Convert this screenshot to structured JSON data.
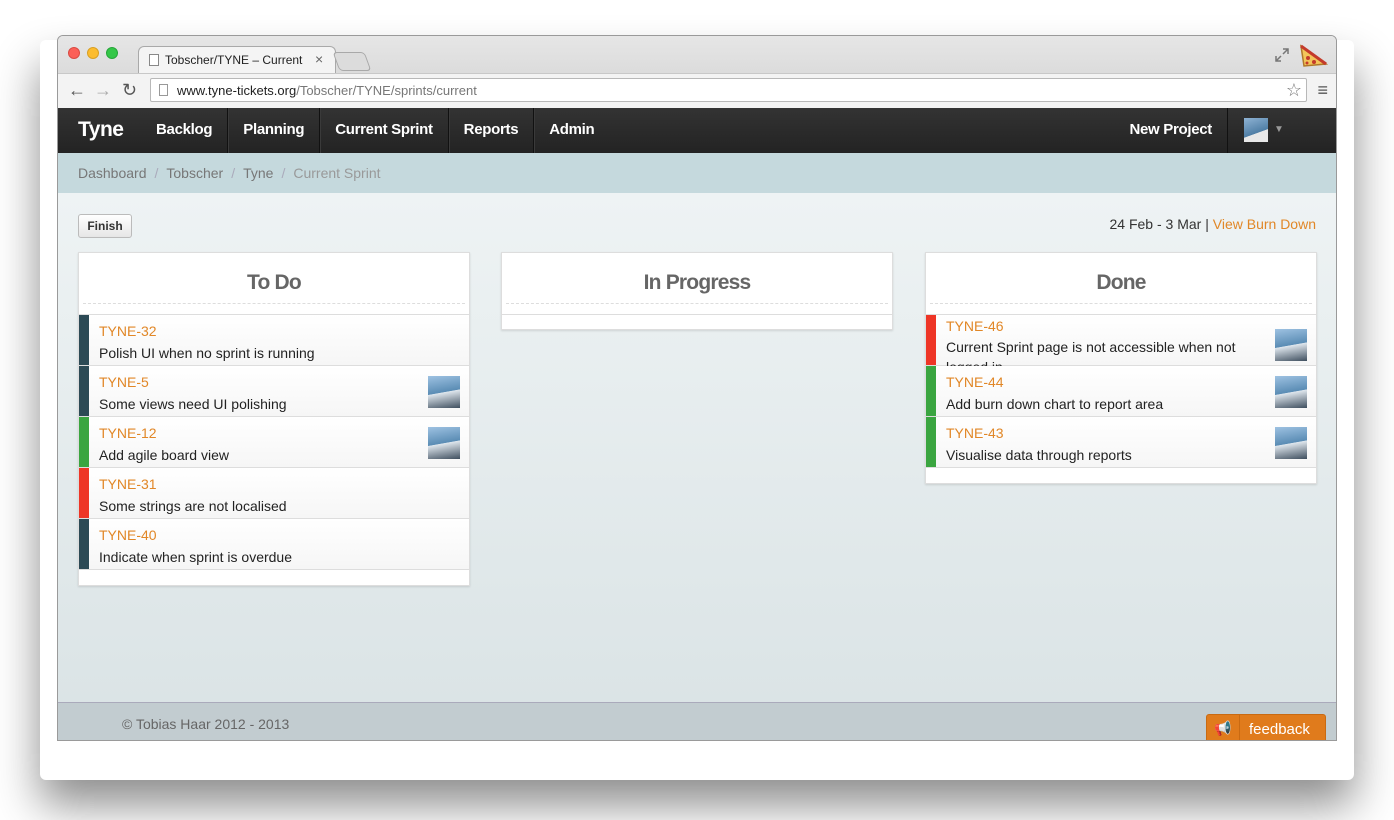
{
  "browser": {
    "tab_title": "Tobscher/TYNE – Current",
    "tab_close": "×",
    "url_host": "www.tyne-tickets.org",
    "url_path": "/Tobscher/TYNE/sprints/current"
  },
  "navbar": {
    "brand": "Tyne",
    "items": [
      "Backlog",
      "Planning",
      "Current Sprint",
      "Reports",
      "Admin"
    ],
    "new_project": "New Project"
  },
  "breadcrumb": [
    "Dashboard",
    "Tobscher",
    "Tyne",
    "Current Sprint"
  ],
  "sprint": {
    "finish_label": "Finish",
    "date_range": "24 Feb - 3 Mar",
    "separator": "|",
    "burn_down_link": "View Burn Down"
  },
  "columns": {
    "todo": {
      "title": "To Do",
      "cards": [
        {
          "key": "TYNE-32",
          "title": "Polish UI when no sprint is running",
          "color": "#2c4a55",
          "avatar": false
        },
        {
          "key": "TYNE-5",
          "title": "Some views need UI polishing",
          "color": "#2c4a55",
          "avatar": true
        },
        {
          "key": "TYNE-12",
          "title": "Add agile board view",
          "color": "#3aa540",
          "avatar": true
        },
        {
          "key": "TYNE-31",
          "title": "Some strings are not localised",
          "color": "#ee3526",
          "avatar": false
        },
        {
          "key": "TYNE-40",
          "title": "Indicate when sprint is overdue",
          "color": "#2c4a55",
          "avatar": false
        }
      ]
    },
    "in_progress": {
      "title": "In Progress",
      "cards": []
    },
    "done": {
      "title": "Done",
      "cards": [
        {
          "key": "TYNE-46",
          "title": "Current Sprint page is not accessible when not logged in",
          "color": "#ee3526",
          "avatar": true
        },
        {
          "key": "TYNE-44",
          "title": "Add burn down chart to report area",
          "color": "#3aa540",
          "avatar": true
        },
        {
          "key": "TYNE-43",
          "title": "Visualise data through reports",
          "color": "#3aa540",
          "avatar": true
        }
      ]
    }
  },
  "footer": {
    "copyright": "© Tobias Haar 2012 - 2013",
    "feedback": "feedback"
  }
}
